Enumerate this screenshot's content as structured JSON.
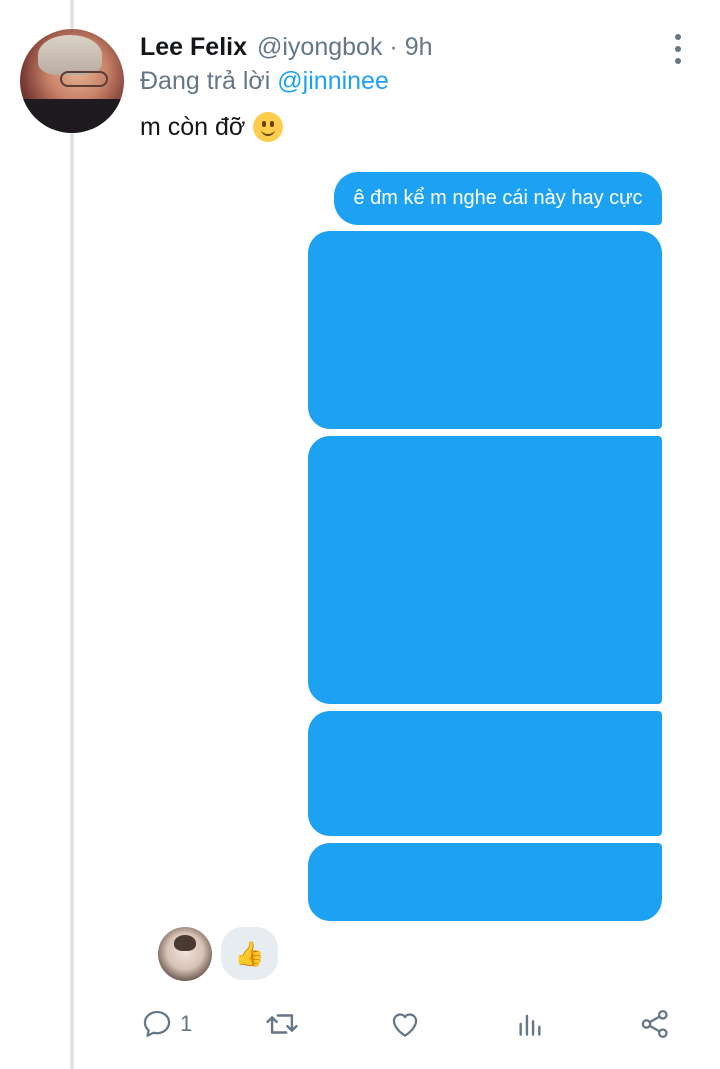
{
  "tweet": {
    "display_name": "Lee Felix",
    "handle": "@iyongbok",
    "separator": "·",
    "time": "9h",
    "reply_prefix": "Đang trả lời",
    "reply_mention": "@jinninee",
    "text": "m còn đỡ",
    "emoji": "slightly-smiling-face"
  },
  "dm": {
    "first_message": "ê đm kể m nghe cái này hay cực",
    "bubble_color": "#1da1f2",
    "redacted_bubbles": 4,
    "reaction_emoji": "👍"
  },
  "actions": {
    "reply_count": "1"
  },
  "colors": {
    "accent": "#1da1f2",
    "secondary_text": "#657786",
    "primary_text": "#14171a"
  }
}
